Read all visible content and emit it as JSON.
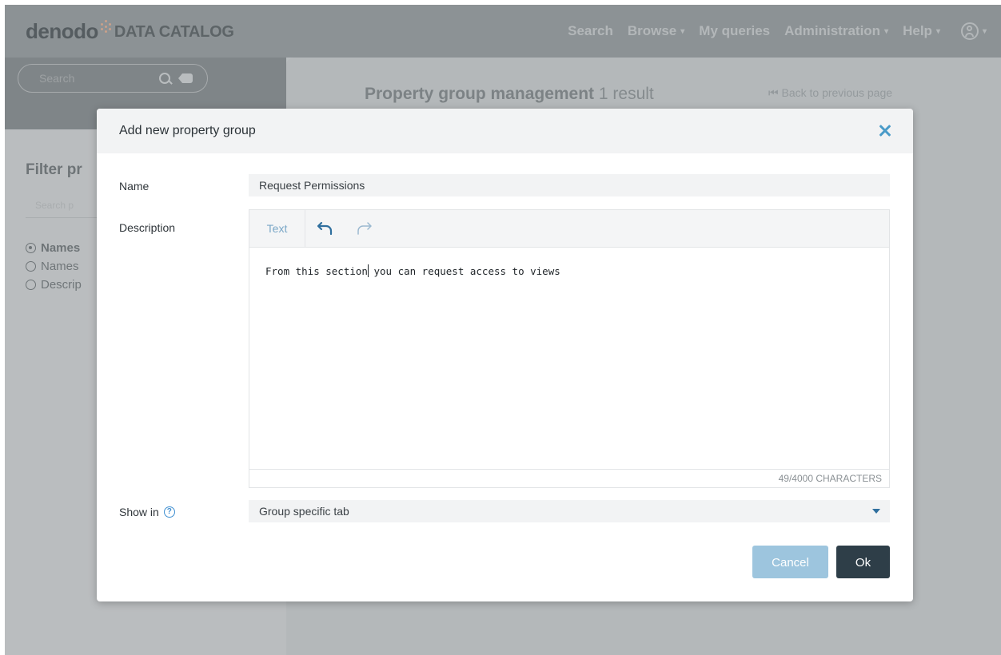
{
  "header": {
    "brand_word": "denodo",
    "brand_product": "DATA CATALOG",
    "nav": [
      {
        "label": "Search",
        "has_caret": false
      },
      {
        "label": "Browse",
        "has_caret": true
      },
      {
        "label": "My queries",
        "has_caret": false
      },
      {
        "label": "Administration",
        "has_caret": true
      },
      {
        "label": "Help",
        "has_caret": true
      }
    ],
    "caret_glyph": "▾"
  },
  "sidebar": {
    "search_placeholder": "Search",
    "filter_title": "Filter pr",
    "filter_search_placeholder": "Search p",
    "radios": [
      {
        "label": "Names",
        "selected": true
      },
      {
        "label": "Names",
        "selected": false
      },
      {
        "label": "Descrip",
        "selected": false
      }
    ]
  },
  "main": {
    "title": "Property group management",
    "result_count": "1 result",
    "back_link": "⏮ Back to previous page"
  },
  "modal": {
    "title": "Add new property group",
    "name_label": "Name",
    "name_value": "Request Permissions",
    "description_label": "Description",
    "editor_tab": "Text",
    "description_before_caret": "From this section",
    "description_after_caret": " you can request access to views",
    "char_count": "49/4000 CHARACTERS",
    "show_in_label": "Show in",
    "help_glyph": "?",
    "show_in_value": "Group specific tab",
    "cancel_label": "Cancel",
    "ok_label": "Ok"
  },
  "colors": {
    "accent": "#4a9bc8",
    "primary_button": "#2e3e48",
    "secondary_button": "#9dc5de",
    "overlay": "#b8bcbe"
  }
}
